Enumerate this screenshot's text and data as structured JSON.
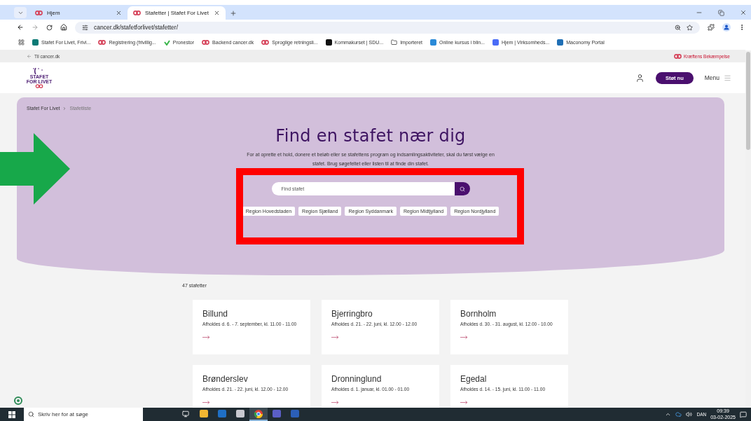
{
  "browser": {
    "tabs": [
      {
        "title": "Hjem",
        "selected": false
      },
      {
        "title": "Stafetter | Stafet For Livet",
        "selected": true
      }
    ],
    "url": "cancer.dk/stafetforlivet/stafetter/",
    "bookmarks": [
      {
        "label": "Stafet For Livet, Frivi...",
        "kind": "share"
      },
      {
        "label": "Registrering (frivillig...",
        "kind": "cancer"
      },
      {
        "label": "Pronestor",
        "kind": "check"
      },
      {
        "label": "Backend cancer.dk",
        "kind": "cancer"
      },
      {
        "label": "Sproglige retningsli...",
        "kind": "cancer"
      },
      {
        "label": "Kommakurset | SDU...",
        "kind": "dark"
      },
      {
        "label": "Importeret",
        "kind": "folder"
      },
      {
        "label": "Online kursus i blin...",
        "kind": "ts"
      },
      {
        "label": "Hjem | Virksomheds...",
        "kind": "doc"
      },
      {
        "label": "Maconomy Portal",
        "kind": "portal"
      }
    ]
  },
  "topbar": {
    "back_link": "Til cancer.dk",
    "org_link": "Kræftens Bekæmpelse"
  },
  "header": {
    "logo": [
      "STAFET",
      "FOR LIVET"
    ],
    "donate_button": "Støt nu",
    "menu": "Menu"
  },
  "breadcrumb": [
    {
      "label": "Stafet For Livet"
    },
    {
      "label": "Stafetliste"
    }
  ],
  "hero": {
    "title": "Find en stafet nær dig",
    "text": "For at oprette et hold, donere et beløb eller se stafettens program og indsamlingsaktiviteter, skal du først vælge en stafet. Brug søgefeltet eller listen til at finde din stafet.",
    "search_placeholder": "Find stafet",
    "regions": [
      "Region Hovedstaden",
      "Region Sjælland",
      "Region Syddanmark",
      "Region Midtjylland",
      "Region Nordjylland"
    ]
  },
  "count": "47 stafetter",
  "cards": [
    {
      "name": "Billund",
      "dates": "Afholdes d. 6. - 7. september, kl. 11.00 - 11.00"
    },
    {
      "name": "Bjerringbro",
      "dates": "Afholdes d. 21. - 22. juni, kl. 12.00 - 12.00"
    },
    {
      "name": "Bornholm",
      "dates": "Afholdes d. 30. - 31. august, kl. 12.00 - 10.00"
    },
    {
      "name": "Brønderslev",
      "dates": "Afholdes d. 21. - 22. juni, kl. 12.00 - 12.00"
    },
    {
      "name": "Dronninglund",
      "dates": "Afholdes d. 1. januar, kl. 01.00 - 01.00"
    },
    {
      "name": "Egedal",
      "dates": "Afholdes d. 14. - 15. juni, kl. 11.00 - 11.00"
    }
  ],
  "annotations": [
    {
      "kind": "arrow",
      "color": "#17a84a"
    },
    {
      "kind": "frame",
      "color": "#ff0000"
    }
  ],
  "taskbar": {
    "search_placeholder": "Skriv her for at søge",
    "apps": [
      {
        "kind": "taskview",
        "selected": false
      },
      {
        "kind": "files",
        "selected": false
      },
      {
        "kind": "mail",
        "selected": false
      },
      {
        "kind": "disc",
        "selected": false
      },
      {
        "kind": "chrome",
        "selected": true
      },
      {
        "kind": "teams",
        "selected": false
      },
      {
        "kind": "word",
        "selected": false
      }
    ],
    "language": "DAN",
    "time": "09:39",
    "date": "03-02-2025"
  }
}
